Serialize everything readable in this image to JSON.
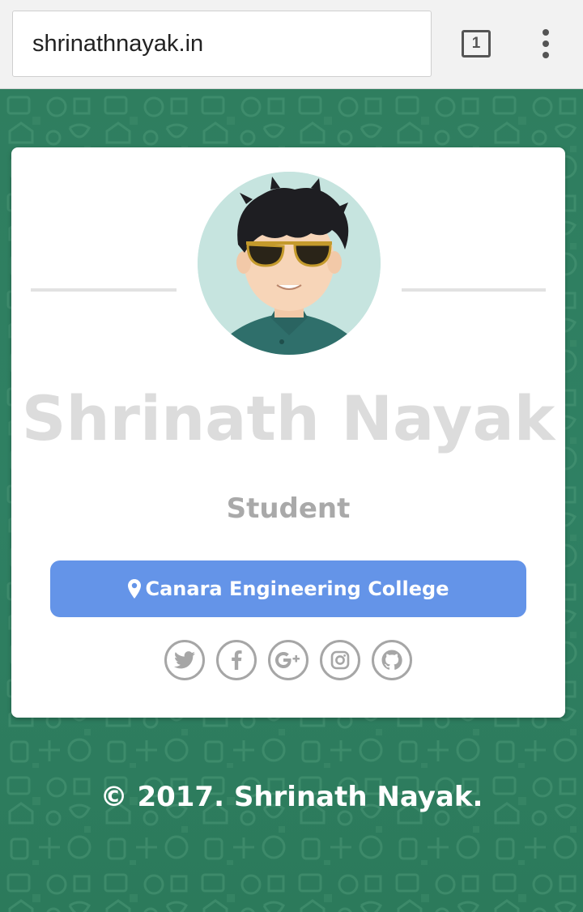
{
  "browser": {
    "url": "shrinathnayak.in",
    "tab_count": "1",
    "menu_icon": "more-vert-icon"
  },
  "profile": {
    "name": "Shrinath Nayak",
    "role": "Student",
    "college": "Canara Engineering College",
    "college_icon": "map-marker-icon"
  },
  "socials": [
    {
      "name": "twitter",
      "icon": "twitter-icon"
    },
    {
      "name": "facebook",
      "icon": "facebook-icon"
    },
    {
      "name": "google-plus",
      "icon": "google-plus-icon"
    },
    {
      "name": "instagram",
      "icon": "instagram-icon"
    },
    {
      "name": "github",
      "icon": "github-icon"
    }
  ],
  "footer": {
    "text": "© 2017. Shrinath Nayak."
  },
  "colors": {
    "background": "#2e7d5e",
    "button": "#6494e8",
    "name_text": "#dcdcdc",
    "role_text": "#a9a9a9",
    "social_icons": "#a6a6a6"
  }
}
